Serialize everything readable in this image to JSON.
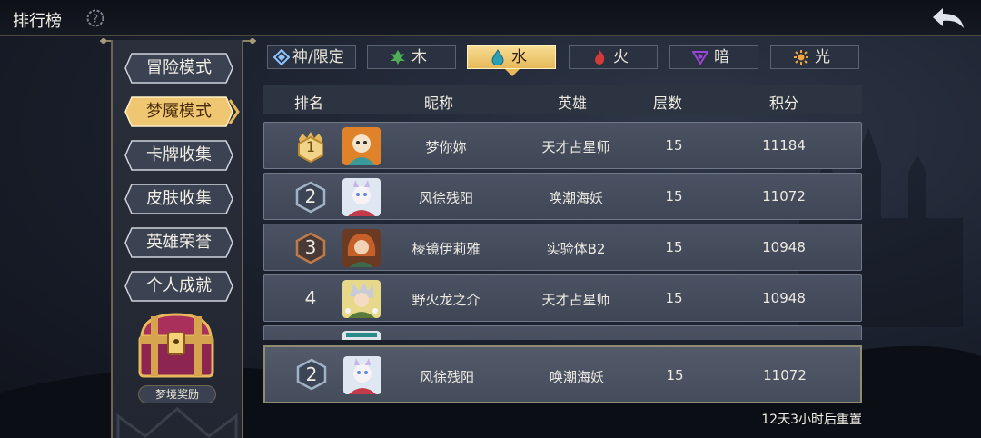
{
  "header": {
    "title": "排行榜",
    "help_icon": "help-gear-icon",
    "back_icon": "back-arrow-icon"
  },
  "sidebar": {
    "items": [
      {
        "label": "冒险模式",
        "active": false
      },
      {
        "label": "梦魇模式",
        "active": true
      },
      {
        "label": "卡牌收集",
        "active": false
      },
      {
        "label": "皮肤收集",
        "active": false
      },
      {
        "label": "英雄荣誉",
        "active": false
      },
      {
        "label": "个人成就",
        "active": false
      }
    ],
    "reward_label": "梦境奖励"
  },
  "tabs": [
    {
      "label": "神/限定",
      "icon": "diamond-icon",
      "active": false
    },
    {
      "label": "木",
      "icon": "leaf-icon",
      "active": false
    },
    {
      "label": "水",
      "icon": "droplet-icon",
      "active": true
    },
    {
      "label": "火",
      "icon": "flame-icon",
      "active": false
    },
    {
      "label": "暗",
      "icon": "dark-triangle-icon",
      "active": false
    },
    {
      "label": "光",
      "icon": "sun-icon",
      "active": false
    }
  ],
  "table": {
    "headers": [
      "排名",
      "昵称",
      "英雄",
      "层数",
      "积分"
    ],
    "rows": [
      {
        "rank": "1",
        "name": "梦你妳",
        "hero": "天才占星师",
        "floor": "15",
        "score": "11184"
      },
      {
        "rank": "2",
        "name": "风徐残阳",
        "hero": "唤潮海妖",
        "floor": "15",
        "score": "11072"
      },
      {
        "rank": "3",
        "name": "棱镜伊莉雅",
        "hero": "实验体B2",
        "floor": "15",
        "score": "10948"
      },
      {
        "rank": "4",
        "name": "野火龙之介",
        "hero": "天才占星师",
        "floor": "15",
        "score": "10948"
      }
    ]
  },
  "self_row": {
    "rank": "2",
    "name": "风徐残阳",
    "hero": "唤潮海妖",
    "floor": "15",
    "score": "11072"
  },
  "reset_text": "12天3小时后重置",
  "colors": {
    "gold": "#e7b95a",
    "silver": "#9fb2c8",
    "bronze": "#c07a4a",
    "water": "#39b3c9",
    "wood": "#4fae55",
    "fire": "#d33a3a",
    "dark": "#9b46d6",
    "light": "#f0a63a"
  }
}
